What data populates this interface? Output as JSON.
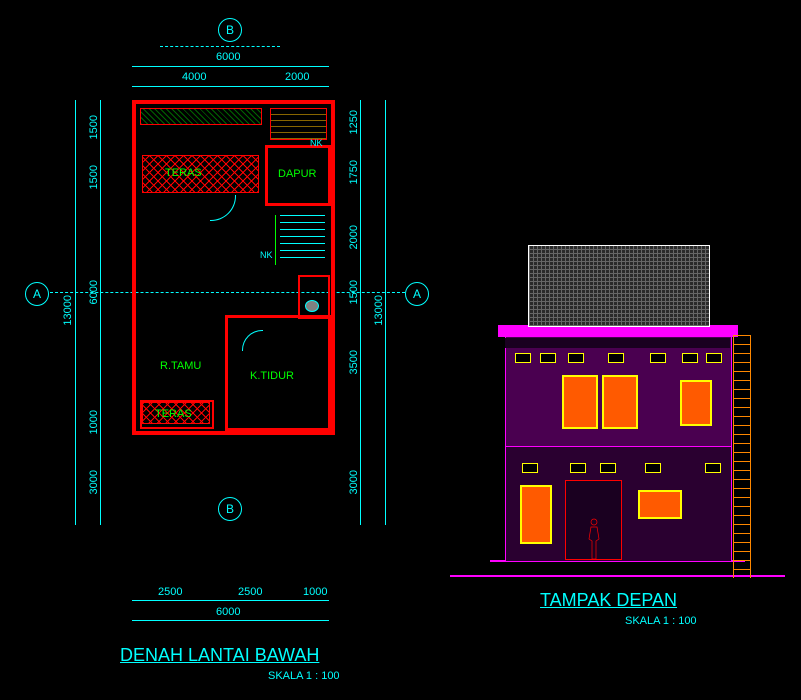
{
  "floorplan": {
    "title": "DENAH LANTAI BAWAH",
    "scale": "SKALA 1 : 100",
    "dimensions": {
      "top_total": "6000",
      "top_left": "4000",
      "top_right": "2000",
      "left_total": "13000",
      "left_s1": "1500",
      "left_s2": "1500",
      "left_s3": "6000",
      "left_s4": "1000",
      "left_s5": "3000",
      "right_total": "13000",
      "right_s1": "1250",
      "right_s2": "1750",
      "right_s3": "2000",
      "right_s4": "1500",
      "right_s5": "3500",
      "right_s6": "3000",
      "bottom_total": "6000",
      "bottom_s1": "2500",
      "bottom_s2": "2500",
      "bottom_s3": "1000"
    },
    "rooms": {
      "teras1": "TERAS",
      "dapur": "DAPUR",
      "rtamu": "R.TAMU",
      "ktidur": "K.TIDUR",
      "teras2": "TERAS"
    },
    "labels": {
      "nk1": "NK",
      "nk2": "NK"
    },
    "sections": {
      "a_left": "A",
      "a_right": "A",
      "b_top": "B",
      "b_bottom": "B"
    }
  },
  "elevation": {
    "title": "TAMPAK DEPAN",
    "scale": "SKALA 1 : 100"
  }
}
